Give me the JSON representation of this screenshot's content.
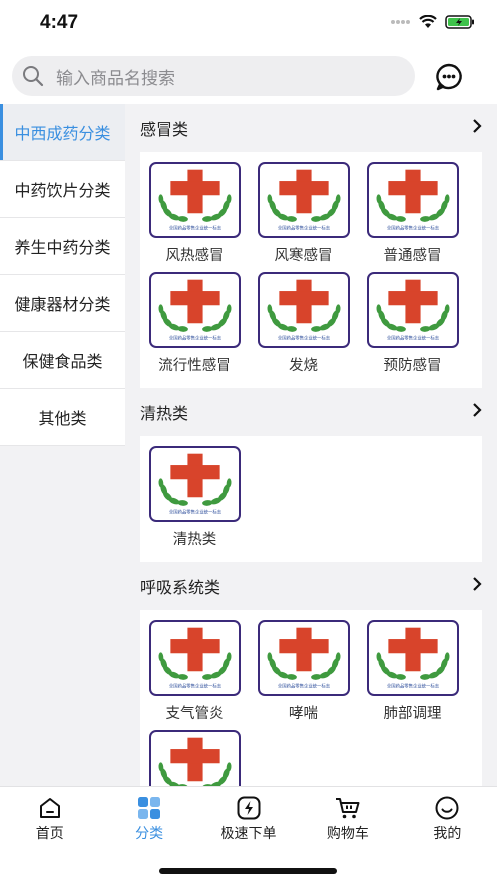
{
  "status": {
    "time": "4:47"
  },
  "search": {
    "placeholder": "输入商品名搜索"
  },
  "sidebar": {
    "items": [
      {
        "label": "中西成药分类",
        "active": true
      },
      {
        "label": "中药饮片分类",
        "active": false
      },
      {
        "label": "养生中药分类",
        "active": false
      },
      {
        "label": "健康器材分类",
        "active": false
      },
      {
        "label": "保健食品类",
        "active": false
      },
      {
        "label": "其他类",
        "active": false
      }
    ]
  },
  "sections": [
    {
      "title": "感冒类",
      "products": [
        "风热感冒",
        "风寒感冒",
        "普通感冒",
        "流行性感冒",
        "发烧",
        "预防感冒"
      ]
    },
    {
      "title": "清热类",
      "products": [
        "清热类"
      ]
    },
    {
      "title": "呼吸系统类",
      "products": [
        "支气管炎",
        "哮喘",
        "肺部调理",
        ""
      ]
    }
  ],
  "product_logo_caption": "全国药品零售企业统一标志",
  "tabbar": {
    "items": [
      {
        "label": "首页",
        "icon": "home-icon",
        "active": false
      },
      {
        "label": "分类",
        "icon": "category-icon",
        "active": true
      },
      {
        "label": "极速下单",
        "icon": "lightning-icon",
        "active": false
      },
      {
        "label": "购物车",
        "icon": "cart-icon",
        "active": false
      },
      {
        "label": "我的",
        "icon": "profile-icon",
        "active": false
      }
    ]
  },
  "colors": {
    "accent": "#3a8fe0",
    "cross": "#d8442b",
    "laurel": "#3f9a3f",
    "frame": "#3b2a7a"
  }
}
